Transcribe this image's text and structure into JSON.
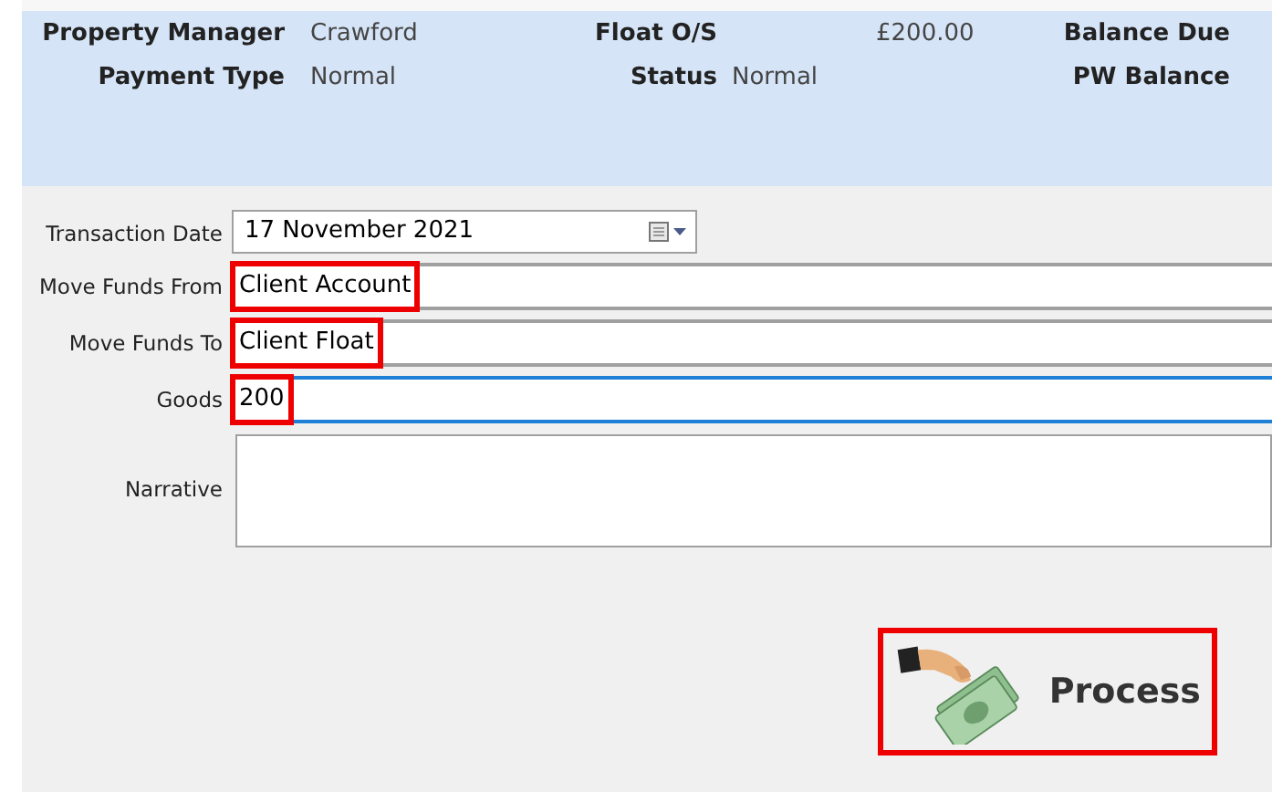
{
  "summary": [
    {
      "label": "Property Manager",
      "value": "Crawford"
    },
    {
      "label": "Payment Type",
      "value": "Normal"
    },
    {
      "label": "Float O/S",
      "value": "£200.00"
    },
    {
      "label": "Status",
      "value": "Normal"
    },
    {
      "label": "Balance Due"
    },
    {
      "label": "PW Balance"
    }
  ],
  "form": [
    {
      "kind": "date",
      "label": "Transaction Date",
      "value": "17 November 2021",
      "highlighted": false,
      "focused": false
    },
    {
      "kind": "text",
      "label": "Move Funds From",
      "value": "Client Account",
      "highlighted": true,
      "focused": false
    },
    {
      "kind": "text",
      "label": "Move Funds To",
      "value": "Client Float",
      "highlighted": true,
      "focused": false
    },
    {
      "kind": "text",
      "label": "Goods",
      "value": "200",
      "highlighted": true,
      "focused": true
    },
    {
      "kind": "area",
      "label": "Narrative",
      "highlighted": false,
      "focused": false
    }
  ],
  "process_button": {
    "label": "Process",
    "highlighted": true
  }
}
